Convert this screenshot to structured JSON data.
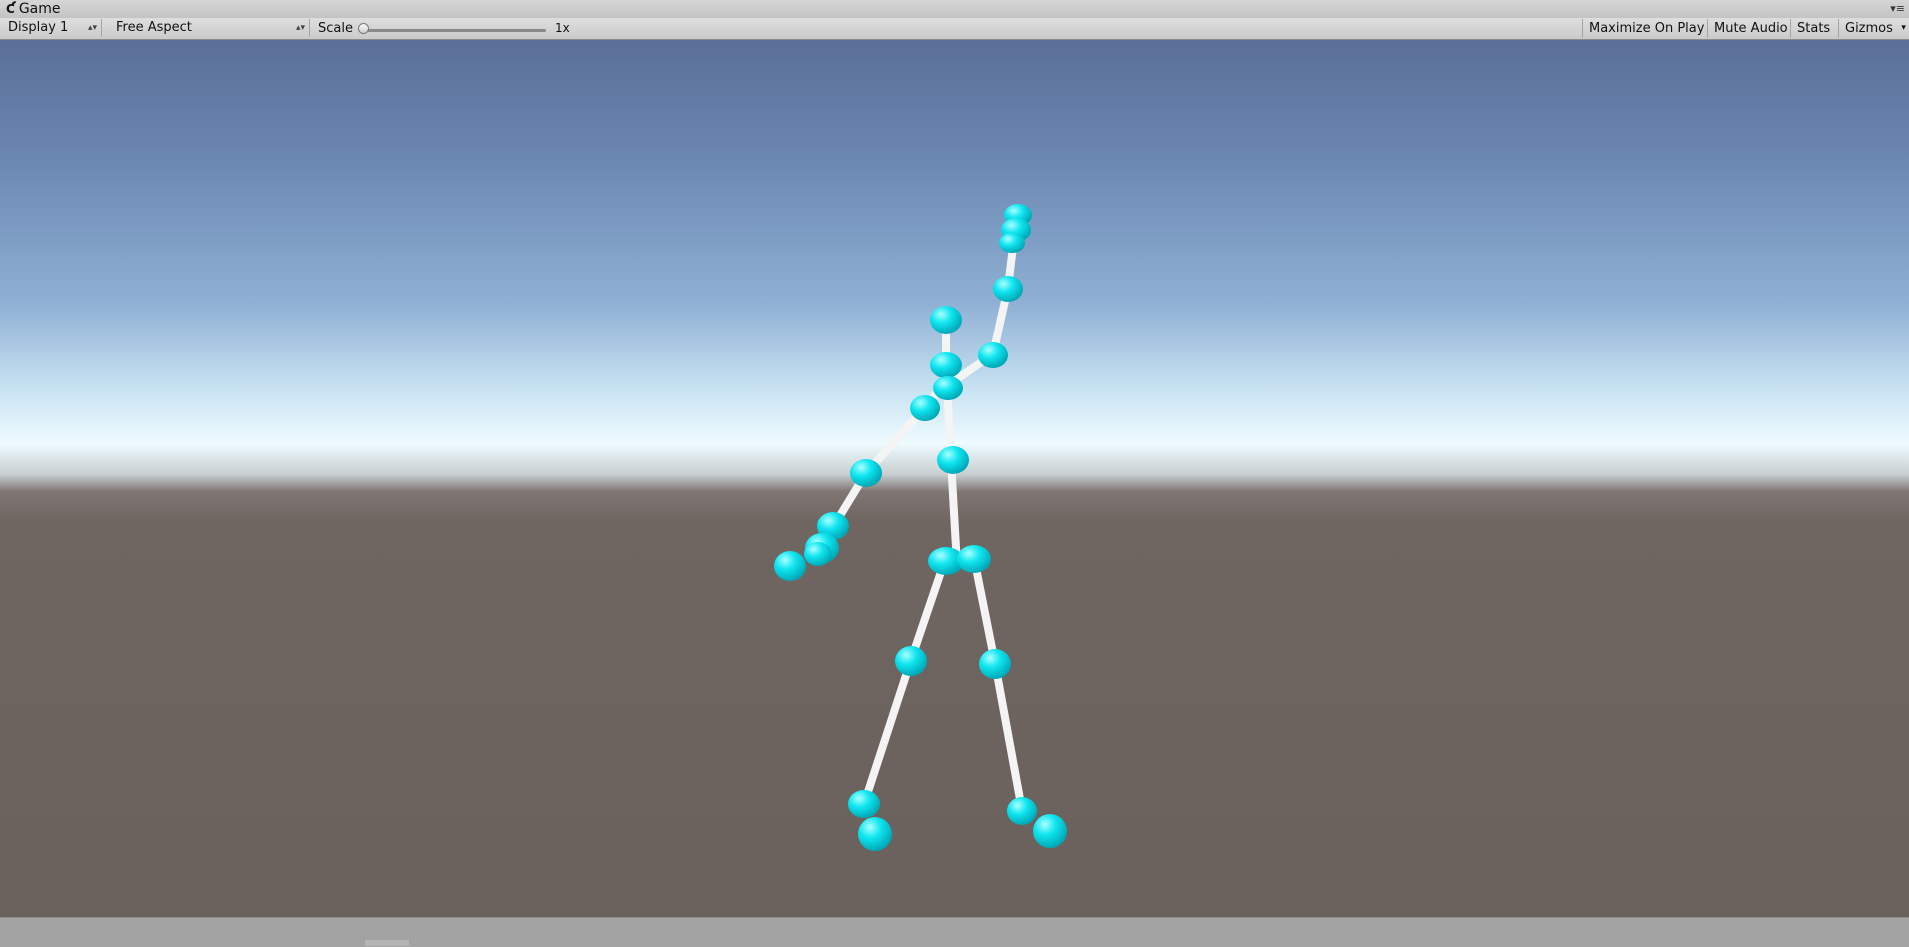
{
  "window": {
    "tab_title": "Game",
    "tab_icon": "game-controller-icon",
    "tab_menu_glyph": "▾≡"
  },
  "toolbar": {
    "display": "Display 1",
    "aspect": "Free Aspect",
    "scale_label": "Scale",
    "scale_value": "1x",
    "scale_level": 0,
    "maximize_on_play": "Maximize On Play",
    "mute_audio": "Mute Audio",
    "stats": "Stats",
    "gizmos": "Gizmos"
  },
  "scene": {
    "sky_top": "#5a6f97",
    "horizon": "#eefbff",
    "ground": "#6a605c",
    "joint_color": "#00e5ee",
    "bone_color": "#ffffff",
    "object": "stick-figure-skeleton"
  }
}
